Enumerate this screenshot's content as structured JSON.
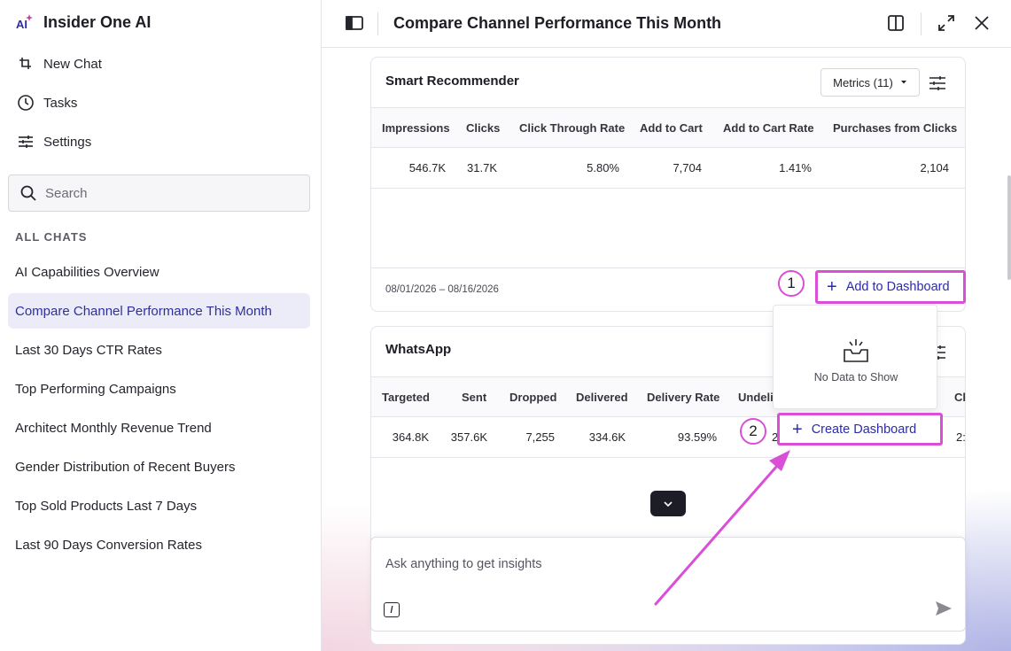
{
  "app": {
    "title": "Insider One AI"
  },
  "nav": {
    "new_chat": "New Chat",
    "tasks": "Tasks",
    "settings": "Settings"
  },
  "search": {
    "placeholder": "Search"
  },
  "chats": {
    "section_label": "ALL CHATS",
    "items": [
      "AI Capabilities Overview",
      "Compare Channel Performance This Month",
      "Last 30 Days CTR Rates",
      "Top Performing Campaigns",
      "Architect Monthly Revenue Trend",
      "Gender Distribution of Recent Buyers",
      "Top Sold Products Last 7 Days",
      "Last 90 Days Conversion Rates"
    ],
    "active_index": 1
  },
  "header": {
    "title": "Compare Channel Performance This Month"
  },
  "smart_recommender": {
    "title": "Smart Recommender",
    "metrics_label": "Metrics (11)",
    "columns": [
      "Impressions",
      "Clicks",
      "Click Through Rate",
      "Add to Cart",
      "Add to Cart Rate",
      "Purchases from Clicks"
    ],
    "values": [
      "546.7K",
      "31.7K",
      "5.80%",
      "7,704",
      "1.41%",
      "2,104"
    ],
    "date_range": "08/01/2026 – 08/16/2026",
    "add_to_dashboard": "Add to Dashboard"
  },
  "whatsapp": {
    "title": "WhatsApp",
    "columns": [
      "Targeted",
      "Sent",
      "Dropped",
      "Delivered",
      "Delivery Rate",
      "Undeli",
      "Cl"
    ],
    "values": [
      "364.8K",
      "357.6K",
      "7,255",
      "334.6K",
      "93.59%",
      "2",
      "2:"
    ]
  },
  "popup": {
    "no_data": "No Data to Show",
    "create_dashboard": "Create Dashboard"
  },
  "annotations": {
    "step1": "1",
    "step2": "2"
  },
  "composer": {
    "placeholder": "Ask anything to get insights",
    "slash": "/"
  },
  "colors": {
    "accent": "#2b2bab",
    "highlight": "#d94fd6",
    "active_bg": "#ececf8"
  }
}
